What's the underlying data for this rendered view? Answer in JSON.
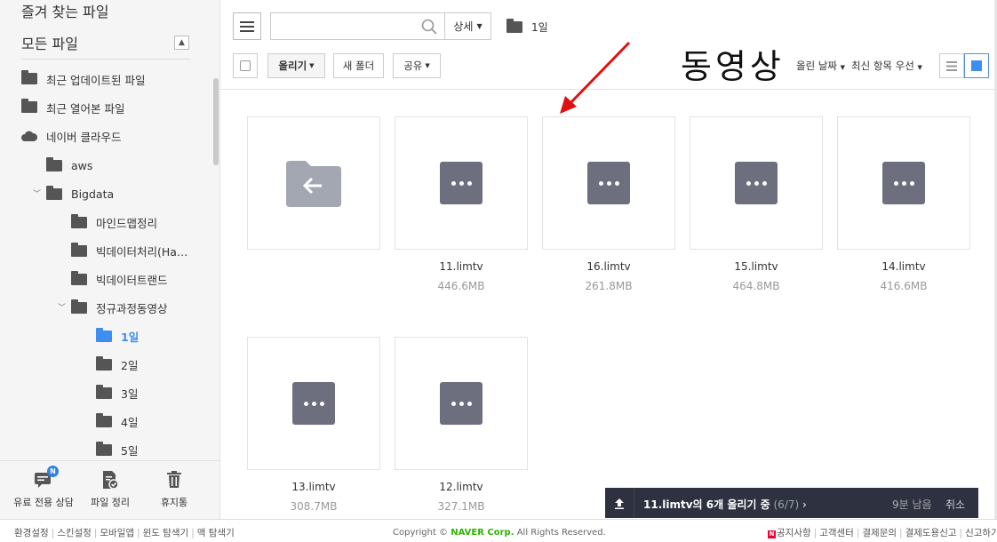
{
  "sidebar": {
    "favorites": "즐겨 찾는 파일",
    "all_files": "모든 파일",
    "items": [
      {
        "label": "최근 업데이트된 파일"
      },
      {
        "label": "최근 열어본 파일"
      },
      {
        "label": "네이버 클라우드"
      },
      {
        "label": "aws"
      },
      {
        "label": "Bigdata"
      },
      {
        "label": "마인드맵정리"
      },
      {
        "label": "빅데이터처리(Ha…"
      },
      {
        "label": "빅데이터트랜드"
      },
      {
        "label": "정규과정동영상"
      },
      {
        "label": "1일"
      },
      {
        "label": "2일"
      },
      {
        "label": "3일"
      },
      {
        "label": "4일"
      },
      {
        "label": "5일"
      }
    ],
    "bottom": {
      "consult": "유료 전용 상담",
      "badge": "N",
      "organize": "파일 정리",
      "trash": "휴지통"
    }
  },
  "toolbar": {
    "search_placeholder": "",
    "detail": "상세",
    "breadcrumb": "1일",
    "upload": "올리기",
    "new_folder": "새 폴더",
    "share": "공유",
    "sort_date": "올린 날짜",
    "sort_order": "최신 항목 우선"
  },
  "annotation": "동영상",
  "files": [
    {
      "name": "11.limtv",
      "size": "446.6MB"
    },
    {
      "name": "16.limtv",
      "size": "261.8MB"
    },
    {
      "name": "15.limtv",
      "size": "464.8MB"
    },
    {
      "name": "14.limtv",
      "size": "416.6MB"
    },
    {
      "name": "13.limtv",
      "size": "308.7MB"
    },
    {
      "name": "12.limtv",
      "size": "327.1MB"
    }
  ],
  "upload_status": {
    "file": "11.limtv",
    "text": "의 6개 올리기 중",
    "count": "(6/7)",
    "remaining": "9분 남음",
    "cancel": "취소"
  },
  "footer": {
    "left_links": [
      "환경설정",
      "스킨설정",
      "모바일앱",
      "윈도 탐색기",
      "맥 탐색기"
    ],
    "copyright_prefix": "Copyright ©",
    "brand": "NAVER Corp.",
    "copyright_suffix": "All Rights Reserved.",
    "right_links": [
      "공지사항",
      "고객센터",
      "결제문의",
      "결제도용신고",
      "신고하기"
    ]
  }
}
